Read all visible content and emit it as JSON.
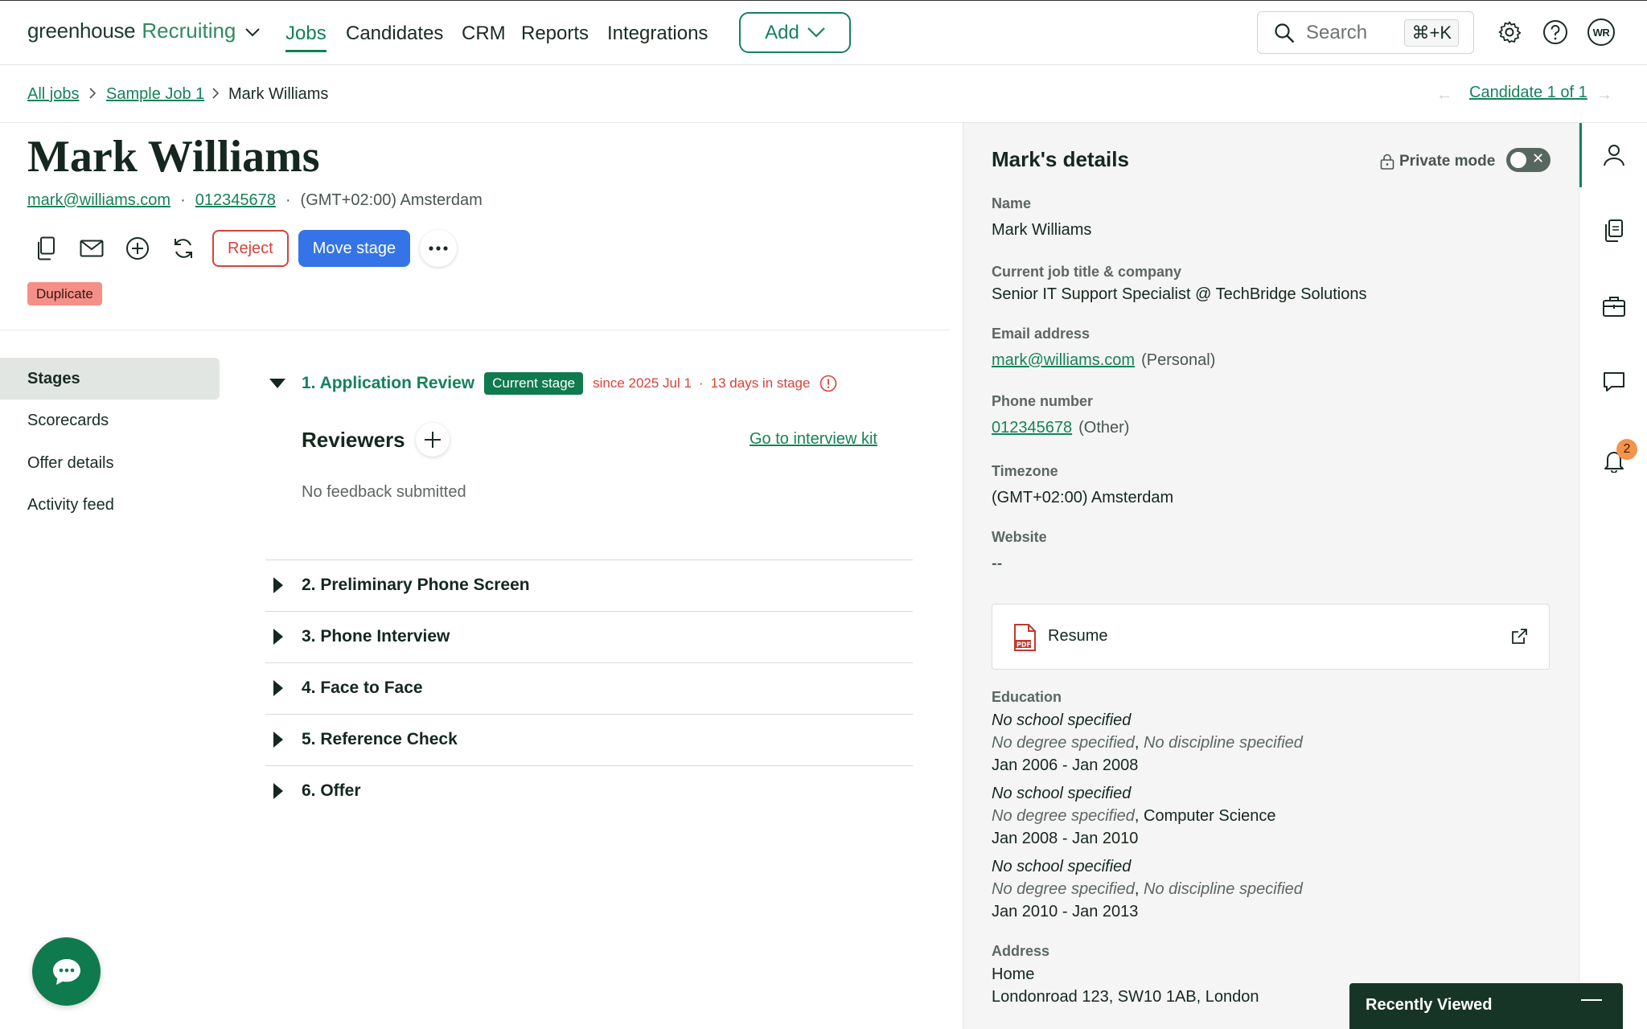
{
  "nav": {
    "brand_main": "greenhouse",
    "brand_product": "Recruiting",
    "items": [
      "Jobs",
      "Candidates",
      "CRM",
      "Reports",
      "Integrations"
    ],
    "active": "Jobs",
    "add_label": "Add",
    "search_placeholder": "Search",
    "search_shortcut": "⌘+K",
    "avatar_initials": "WR"
  },
  "breadcrumb": {
    "all_jobs": "All jobs",
    "job": "Sample Job 1",
    "candidate": "Mark Williams",
    "candidate_nav": "Candidate 1 of 1"
  },
  "candidate": {
    "name": "Mark Williams",
    "email": "mark@williams.com",
    "phone": "012345678",
    "timezone": "(GMT+02:00) Amsterdam",
    "reject_label": "Reject",
    "move_label": "Move stage",
    "badge": "Duplicate"
  },
  "subnav": {
    "items": [
      "Stages",
      "Scorecards",
      "Offer details",
      "Activity feed"
    ],
    "active": "Stages"
  },
  "stages": {
    "current": {
      "title": "1. Application Review",
      "badge": "Current stage",
      "since": "since 2025 Jul 1",
      "days": "13 days in stage",
      "reviewers_label": "Reviewers",
      "kit_link": "Go to interview kit",
      "no_feedback": "No feedback submitted"
    },
    "others": [
      "2. Preliminary Phone Screen",
      "3. Phone Interview",
      "4. Face to Face",
      "5. Reference Check",
      "6. Offer"
    ]
  },
  "details": {
    "title": "Mark's details",
    "private_mode": "Private mode",
    "name_label": "Name",
    "name": "Mark Williams",
    "job_label": "Current job title & company",
    "job": "Senior IT Support Specialist @ TechBridge Solutions",
    "email_label": "Email address",
    "email": "mark@williams.com",
    "email_type": "(Personal)",
    "phone_label": "Phone number",
    "phone": "012345678",
    "phone_type": "(Other)",
    "tz_label": "Timezone",
    "tz": "(GMT+02:00) Amsterdam",
    "website_label": "Website",
    "website": "--",
    "resume": "Resume",
    "education_label": "Education",
    "education": [
      {
        "school": "No school specified",
        "degree": "No degree specified",
        "discipline": "No discipline specified",
        "dates": "Jan 2006 - Jan 2008"
      },
      {
        "school": "No school specified",
        "degree": "No degree specified",
        "discipline": "Computer Science",
        "dates": "Jan 2008 - Jan 2010"
      },
      {
        "school": "No school specified",
        "degree": "No degree specified",
        "discipline": "No discipline specified",
        "dates": "Jan 2010 - Jan 2013"
      }
    ],
    "address_label": "Address",
    "address_type": "Home",
    "address": "Londonroad 123, SW10 1AB, London"
  },
  "rail": {
    "notification_count": "2"
  },
  "recently_viewed": "Recently Viewed",
  "colors": {
    "brand_green": "#168259",
    "primary_blue": "#3574e6",
    "danger_red": "#d6433b",
    "badge_dup": "#f49087",
    "notif_orange": "#f4934a"
  }
}
